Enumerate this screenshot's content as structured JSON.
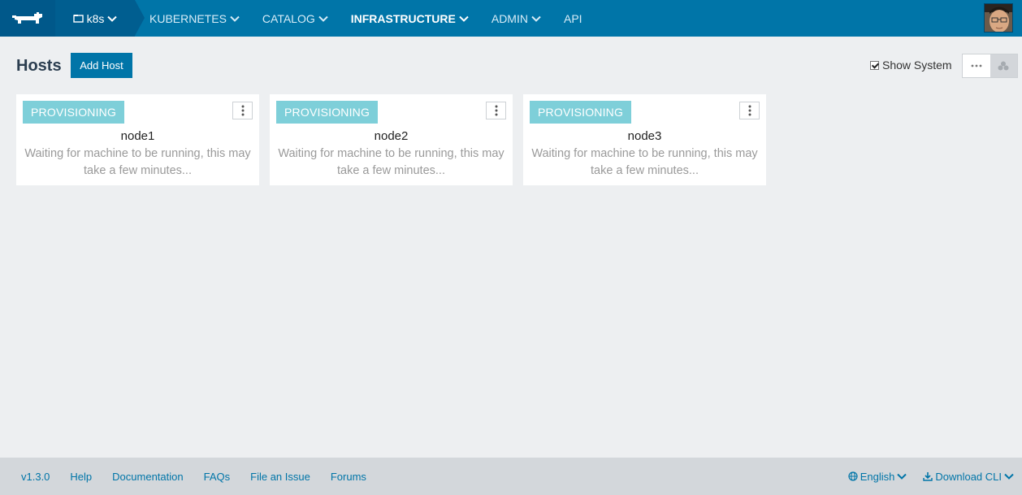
{
  "nav": {
    "environment": "k8s",
    "items": [
      {
        "label": "KUBERNETES",
        "dropdown": true,
        "active": false
      },
      {
        "label": "CATALOG",
        "dropdown": true,
        "active": false
      },
      {
        "label": "INFRASTRUCTURE",
        "dropdown": true,
        "active": true
      },
      {
        "label": "ADMIN",
        "dropdown": true,
        "active": false
      },
      {
        "label": "API",
        "dropdown": false,
        "active": false
      }
    ],
    "brand_color": "#0075a8"
  },
  "header": {
    "title": "Hosts",
    "add_button": "Add Host",
    "show_system_label": "Show System",
    "show_system_checked": true
  },
  "hosts": [
    {
      "state": "PROVISIONING",
      "name": "node1",
      "message": "Waiting for machine to be running, this may take a few minutes..."
    },
    {
      "state": "PROVISIONING",
      "name": "node2",
      "message": "Waiting for machine to be running, this may take a few minutes..."
    },
    {
      "state": "PROVISIONING",
      "name": "node3",
      "message": "Waiting for machine to be running, this may take a few minutes..."
    }
  ],
  "footer": {
    "links": [
      "v1.3.0",
      "Help",
      "Documentation",
      "FAQs",
      "File an Issue",
      "Forums"
    ],
    "language": "English",
    "download": "Download CLI"
  }
}
